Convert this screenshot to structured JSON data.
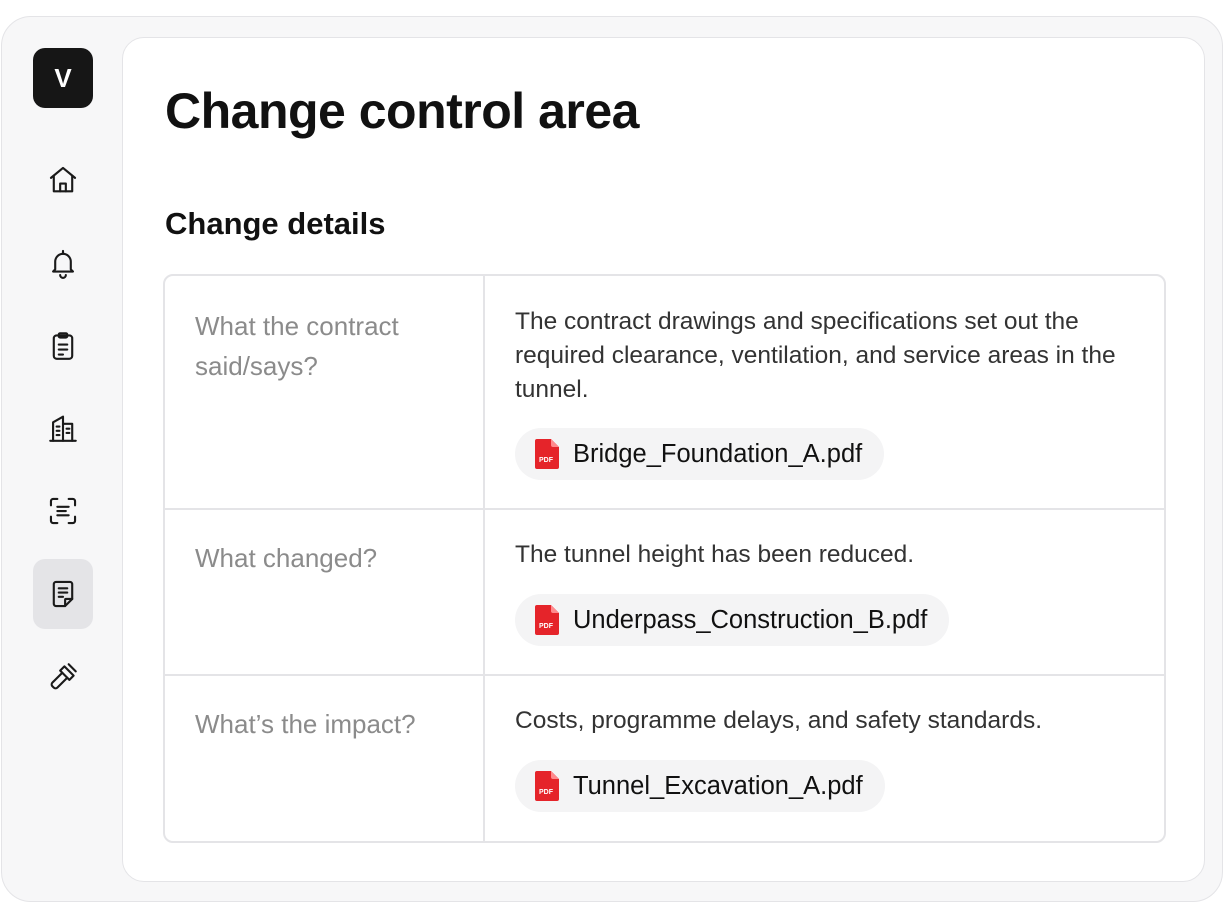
{
  "logo": {
    "letter": "V"
  },
  "sidebar": {
    "items": [
      {
        "name": "home",
        "icon": "home-icon"
      },
      {
        "name": "notifications",
        "icon": "bell-icon"
      },
      {
        "name": "tasks",
        "icon": "clipboard-icon"
      },
      {
        "name": "buildings",
        "icon": "building-icon"
      },
      {
        "name": "scan",
        "icon": "scan-text-icon"
      },
      {
        "name": "change-control",
        "icon": "notes-icon",
        "active": true
      },
      {
        "name": "tools",
        "icon": "hammer-icon"
      }
    ]
  },
  "page": {
    "title": "Change control area",
    "section_title": "Change details"
  },
  "details": {
    "rows": [
      {
        "label": "What the contract said/says?",
        "description": "The contract drawings and specifications set out the required clearance, ventilation, and service areas in the tunnel.",
        "file": "Bridge_Foundation_A.pdf"
      },
      {
        "label": "What changed?",
        "description": "The tunnel height has been reduced.",
        "file": "Underpass_Construction_B.pdf"
      },
      {
        "label": "What’s the impact?",
        "description": "Costs, programme delays, and safety standards.",
        "file": "Tunnel_Excavation_A.pdf"
      }
    ]
  },
  "colors": {
    "accent_dark": "#161616",
    "pdf_red": "#e5242a",
    "label_gray": "#8b8b8b",
    "border": "#e4e4e7"
  }
}
